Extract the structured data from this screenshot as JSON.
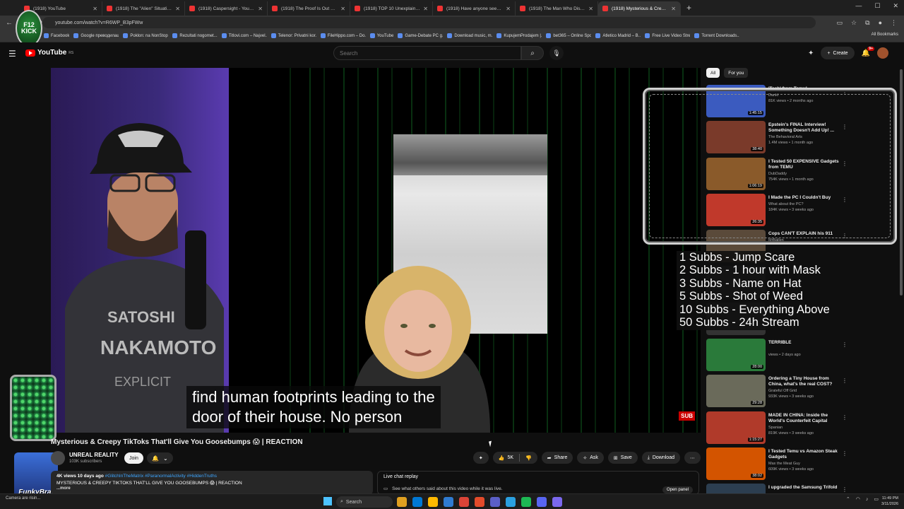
{
  "browser": {
    "tabs": [
      {
        "title": "(1918) YouTube",
        "active": false
      },
      {
        "title": "(1918) The \"Alien\" Situation Is",
        "active": false
      },
      {
        "title": "(1918) Caspersight - YouTube",
        "active": false
      },
      {
        "title": "(1918) The Proof Is Out There",
        "active": false
      },
      {
        "title": "(1918) TOP 10 Unexplained Ph",
        "active": false
      },
      {
        "title": "(1918) Have anyone seen this t",
        "active": false
      },
      {
        "title": "(1918) The Man Who Disappea",
        "active": false
      },
      {
        "title": "(1918) Mysterious & Creepy",
        "active": true
      }
    ],
    "url": "youtube.com/watch?v=R6WP_B3pFWw",
    "bookmarks": [
      "Facebook",
      "Google преводилац",
      "Poklon: na NonStop...",
      "Rezultati nogomet...",
      "Titlovi.com – Najvel...",
      "Telenor: Privatni kor...",
      "FileHippo.com – Do...",
      "YouTube",
      "Game-Debate PC g...",
      "Download music, m...",
      "KupujemProdajem |...",
      "bet365 – Online Spo...",
      "Atletico Madrid – B...",
      "Free Live Video Stre...",
      "Torrent Downloads..."
    ],
    "all_bookmarks": "All Bookmarks"
  },
  "overlay_logo": "F12 KICK",
  "youtube": {
    "logo_text": "YouTube",
    "logo_region": "RS",
    "search_placeholder": "Search",
    "create_label": "Create",
    "notif_count": "9+"
  },
  "video": {
    "caption_line1": "find human footprints leading to the",
    "caption_line2": "door of their house. No person",
    "sub_badge": "SUB",
    "title": "Mysterious & Creepy TikToks That'll Give You Goosebumps 😱 | REACTION",
    "channel_name": "UNREAL REALITY",
    "channel_subs": "103K subscribers",
    "join_label": "Join",
    "like_count": "5K",
    "share_label": "Share",
    "ask_label": "Ask",
    "save_label": "Save",
    "download_label": "Download",
    "desc_meta": "4K views  10 days ago",
    "desc_tags": "#GlitchInTheMatrix #ParanormalActivity #HiddenTruths",
    "desc_line": "MYSTERIOUS & CREEPY TIKTOKS THAT'LL GIVE YOU GOOSEBUMPS 😱 | REACTION",
    "desc_more": "...more",
    "live_chat_title": "Live chat replay",
    "live_chat_sub": "See what others said about this video while it was live.",
    "open_panel": "Open panel"
  },
  "webcam_label": "FunkyBrat",
  "chips": [
    "All",
    "For you"
  ],
  "recommendations": [
    {
      "title": "'Tech' from Temu!",
      "channel": "Dankl",
      "meta": "81K views • 2 months ago",
      "duration": "1:45:15",
      "color": "#3b5bbf"
    },
    {
      "title": "Epstein's FINAL Interview! Something Doesn't Add Up! ...",
      "channel": "The Behavioral Arts",
      "meta": "1.4M views • 1 month ago",
      "duration": "38:40",
      "color": "#7a3a2a"
    },
    {
      "title": "I Tested 50 EXPENSIVE Gadgets from TEMU",
      "channel": "DubDaddy",
      "meta": "754K views • 1 month ago",
      "duration": "1:06:19",
      "color": "#8a5a2a"
    },
    {
      "title": "I Made the PC I Couldn't Buy",
      "channel": "What about the PC?",
      "meta": "184K views • 3 weeks ago",
      "duration": "26:35",
      "color": "#c0392b"
    },
    {
      "title": "Cops CAN'T EXPLAIN his 911",
      "channel": "MrBallen",
      "meta": "",
      "duration": "",
      "color": "#5a4a3a"
    },
    {
      "title": "",
      "channel": "",
      "meta": "",
      "duration": "",
      "color": "#333"
    },
    {
      "title": "",
      "channel": "",
      "meta": "",
      "duration": "",
      "color": "#333"
    },
    {
      "title": "TERRIBLE",
      "channel": "",
      "meta": "views • 2 days ago",
      "duration": "28:00",
      "color": "#2a7a3a"
    },
    {
      "title": "Ordering a Tiny House from China, what's the real COST?",
      "channel": "Grateful Off Grid",
      "meta": "933K views • 3 weeks ago",
      "duration": "29:28",
      "color": "#6a6a5a"
    },
    {
      "title": "MADE IN CHINA: Inside the World's Counterfeit Capital",
      "channel": "Spanian",
      "meta": "819K views • 3 weeks ago",
      "duration": "1:15:27",
      "color": "#b03a2a"
    },
    {
      "title": "I Tested Temu vs Amazon Steak Gadgets",
      "channel": "Max the Meat Guy",
      "meta": "609K views • 3 weeks ago",
      "duration": "38:02",
      "color": "#d35400"
    },
    {
      "title": "I upgraded the Samsung Trifold",
      "channel": "",
      "meta": "",
      "duration": "",
      "color": "#2c3e50"
    }
  ],
  "sub_goals": [
    "1 Subbs - Jump Scare",
    "2 Subbs - 1 hour with Mask",
    "3 Subbs - Name on Hat",
    "5 Subbs - Shot of Weed",
    "10 Subbs - Everything Above",
    "50 Subbs - 24h Stream"
  ],
  "taskbar": {
    "weather": "Camera are risin...",
    "search_label": "Search",
    "clock_time": "11:49 PM",
    "clock_date": "3/11/2026",
    "app_colors": [
      "#e0a020",
      "#0078d4",
      "#ffb900",
      "#2f7bd1",
      "#db4437",
      "#e34b2a",
      "#5b5fc7",
      "#2aa0e0",
      "#1db954",
      "#5865f2",
      "#7b68ee"
    ]
  }
}
